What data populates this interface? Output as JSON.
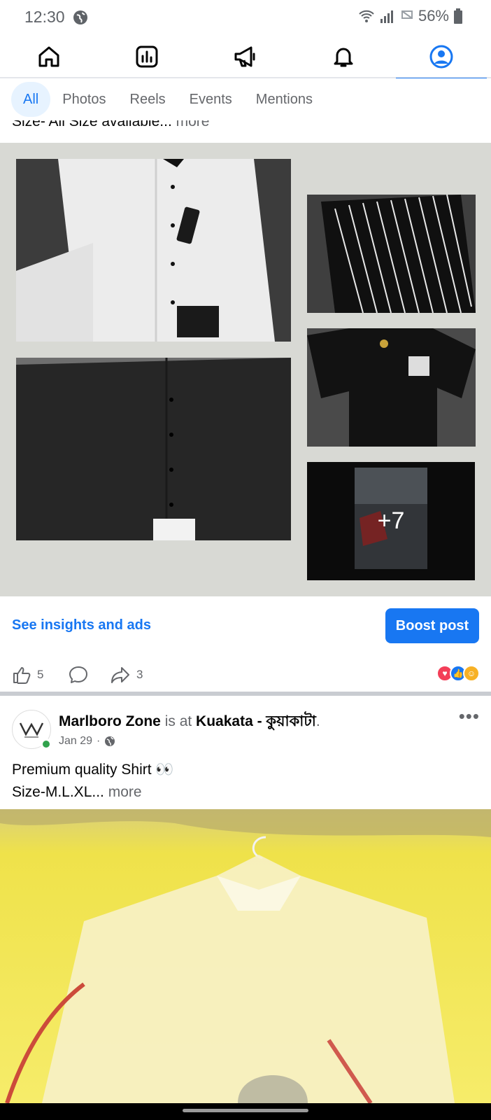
{
  "status": {
    "time": "12:30",
    "battery": "56%"
  },
  "nav": {
    "items": [
      {
        "name": "home-icon"
      },
      {
        "name": "insights-icon"
      },
      {
        "name": "megaphone-icon"
      },
      {
        "name": "bell-icon"
      },
      {
        "name": "profile-icon",
        "active": true
      }
    ]
  },
  "filters": {
    "items": [
      {
        "label": "All",
        "active": true
      },
      {
        "label": "Photos"
      },
      {
        "label": "Reels"
      },
      {
        "label": "Events"
      },
      {
        "label": "Mentions"
      }
    ]
  },
  "previous_post": {
    "caption": "Size- All Size available...",
    "more": "more",
    "more_photos": "+7",
    "insights_label": "See insights and ads",
    "boost_label": "Boost post",
    "likes": "5",
    "shares": "3"
  },
  "post": {
    "author": "Marlboro Zone",
    "is_at": "is at",
    "location": "Kuakata - কুয়াকাটা",
    "period": ".",
    "date": "Jan 29",
    "separator": "·",
    "text_line1": "Premium quality Shirt 👀",
    "text_line2": "Size-M.L.XL...",
    "more": "more"
  },
  "colors": {
    "accent": "#1877f2",
    "gallery_bg": "#d8d9d4"
  }
}
